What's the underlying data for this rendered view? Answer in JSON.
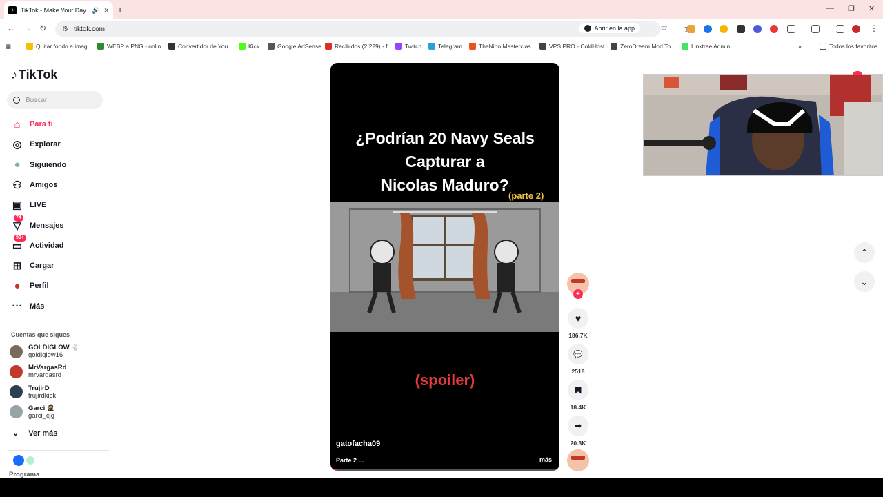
{
  "browser": {
    "tab_title": "TikTok - Make Your Day",
    "url": "tiktok.com",
    "open_in_app": "Abrir en la app",
    "bookmarks": [
      {
        "label": "Quitar fondo a imag...",
        "color": "#f2c200"
      },
      {
        "label": "WEBP a PNG - onlin...",
        "color": "#2d8a2d"
      },
      {
        "label": "Convertidor de You...",
        "color": "#333333"
      },
      {
        "label": "Kick",
        "color": "#53fc18"
      },
      {
        "label": "Google AdSense",
        "color": "#555555"
      },
      {
        "label": "Recibidos (2,229) - f...",
        "color": "#d93025"
      },
      {
        "label": "Twitch",
        "color": "#9146ff"
      },
      {
        "label": "Telegram",
        "color": "#2aa1da"
      },
      {
        "label": "TheNino Masterclas...",
        "color": "#e8541c"
      },
      {
        "label": "VPS PRO - ColdHost...",
        "color": "#444444"
      },
      {
        "label": "ZeroDream Mod To...",
        "color": "#444444"
      },
      {
        "label": "Linktree Admin",
        "color": "#43e660"
      }
    ],
    "all_bookmarks": "Todos los favoritos"
  },
  "sidebar": {
    "brand": "TikTok",
    "search_placeholder": "Buscar",
    "nav": [
      {
        "label": "Para ti",
        "icon": "home-icon",
        "active": true
      },
      {
        "label": "Explorar",
        "icon": "compass-icon"
      },
      {
        "label": "Siguiendo",
        "icon": "following-avatar-icon"
      },
      {
        "label": "Amigos",
        "icon": "friends-icon"
      },
      {
        "label": "LIVE",
        "icon": "live-icon"
      },
      {
        "label": "Mensajes",
        "icon": "messages-icon",
        "badge": "74"
      },
      {
        "label": "Actividad",
        "icon": "activity-icon",
        "badge": "99+"
      },
      {
        "label": "Cargar",
        "icon": "upload-icon"
      },
      {
        "label": "Perfil",
        "icon": "profile-icon"
      },
      {
        "label": "Más",
        "icon": "more-icon"
      }
    ],
    "following_header": "Cuentas que sigues",
    "accounts": [
      {
        "name": "GOLDIGLOW 🐇",
        "handle": "goldiglow16",
        "color": "#7a6a5a"
      },
      {
        "name": "MrVargasRd",
        "handle": "mrvargasrd",
        "color": "#c0392b"
      },
      {
        "name": "TrujirD",
        "handle": "trujirdkick",
        "color": "#2c3e50"
      },
      {
        "name": "Garci 🥷",
        "handle": "garci_cjg",
        "color": "#95a5a6"
      }
    ],
    "see_more": "Ver más",
    "programa": "Programa"
  },
  "video": {
    "title_lines": [
      "¿Podrían 20 Navy Seals",
      "Capturar a",
      "Nicolas Maduro?"
    ],
    "part_tag": "(parte 2)",
    "spoiler": "(spoiler)",
    "author": "gatofacha09_",
    "caption": "Parte 2 ...",
    "more": "más",
    "progress": 0.03
  },
  "actions": {
    "likes": "186.7K",
    "comments": "2518",
    "saves": "18.4K",
    "shares": "20.3K"
  },
  "colors": {
    "accent": "#fe2c55",
    "spoiler": "#e03a3a",
    "part_tag": "#f5c542"
  }
}
